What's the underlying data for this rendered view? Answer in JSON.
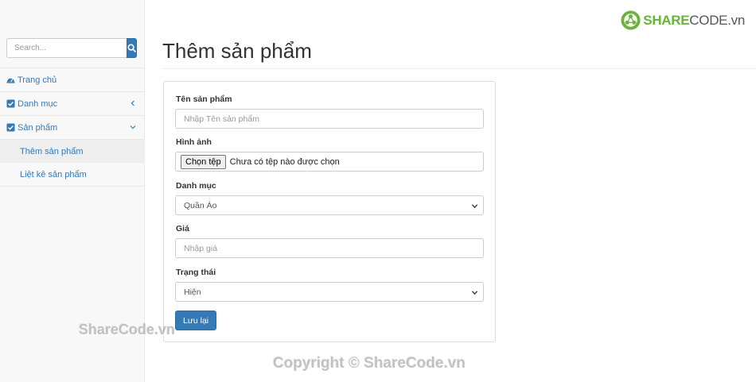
{
  "sidebar": {
    "search": {
      "placeholder": "Search..."
    },
    "menu": {
      "home": "Trang chủ",
      "category": "Danh mục",
      "product": "Sản phẩm",
      "sub_items": [
        "Thêm sản phẩm",
        "Liệt kê sản phẩm"
      ]
    }
  },
  "logo": {
    "part1": "SHARE",
    "part2": "CODE",
    "part3": ".vn"
  },
  "page": {
    "title": "Thêm sản phẩm"
  },
  "form": {
    "name": {
      "label": "Tên sản phẩm",
      "placeholder": "Nhập Tên sản phẩm"
    },
    "image": {
      "label": "Hình ảnh",
      "button": "Chọn tệp",
      "status": "Chưa có tệp nào được chọn"
    },
    "category": {
      "label": "Danh mục",
      "selected": "Quần Áo"
    },
    "price": {
      "label": "Giá",
      "placeholder": "Nhập giá"
    },
    "status": {
      "label": "Trạng thái",
      "selected": "Hiện"
    },
    "submit": "Lưu lại"
  },
  "watermarks": [
    "ShareCode.vn",
    "Copyright © ShareCode.vn"
  ],
  "colors": {
    "primary": "#337ab7",
    "logo_green": "#6bb33e",
    "sidebar_bg": "#f8f8f8"
  }
}
